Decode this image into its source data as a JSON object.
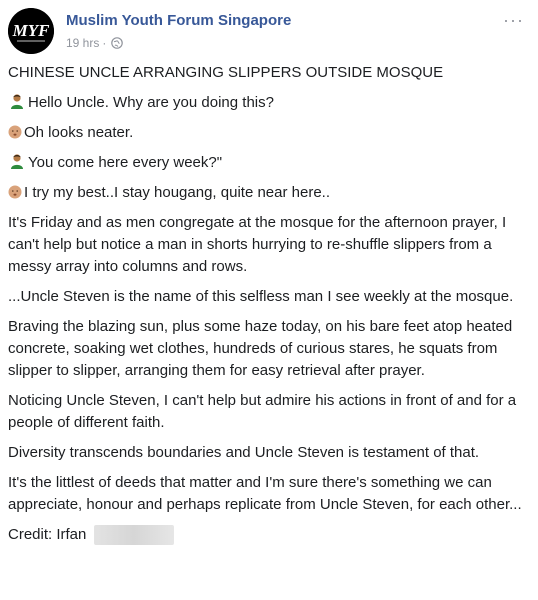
{
  "page": {
    "name": "Muslim Youth Forum Singapore",
    "logo_text": "MYF",
    "timestamp": "19 hrs",
    "separator": "·",
    "more": "···"
  },
  "post": {
    "title": "CHINESE UNCLE ARRANGING SLIPPERS OUTSIDE MOSQUE",
    "dialogue": [
      {
        "speaker_icon": "man-emoji",
        "text": "Hello Uncle. Why are you doing this?"
      },
      {
        "speaker_icon": "face-emoji",
        "text": "Oh looks neater."
      },
      {
        "speaker_icon": "man-emoji",
        "text": "You come here every week?\""
      },
      {
        "speaker_icon": "face-emoji",
        "text": "I try my best..I stay hougang, quite near here.."
      }
    ],
    "paragraphs": [
      "It's Friday and as men congregate at the mosque for the afternoon prayer, I can't help but notice a man in shorts hurrying to re-shuffle slippers from a messy array into columns and rows.",
      "...Uncle Steven is the name of this selfless man I see weekly at the mosque.",
      "Braving the blazing sun, plus some haze today, on his bare feet atop heated concrete, soaking wet clothes, hundreds of curious stares, he squats from slipper to slipper, arranging them for easy retrieval after prayer.",
      "Noticing Uncle Steven, I can't help but admire his actions in front of and for a people of different faith.",
      "Diversity transcends boundaries and Uncle Steven is testament of that.",
      "It's the littlest of deeds that matter and I'm sure there's something we can appreciate, honour and perhaps replicate from Uncle Steven, for each other..."
    ],
    "credit": "Credit: Irfan"
  }
}
